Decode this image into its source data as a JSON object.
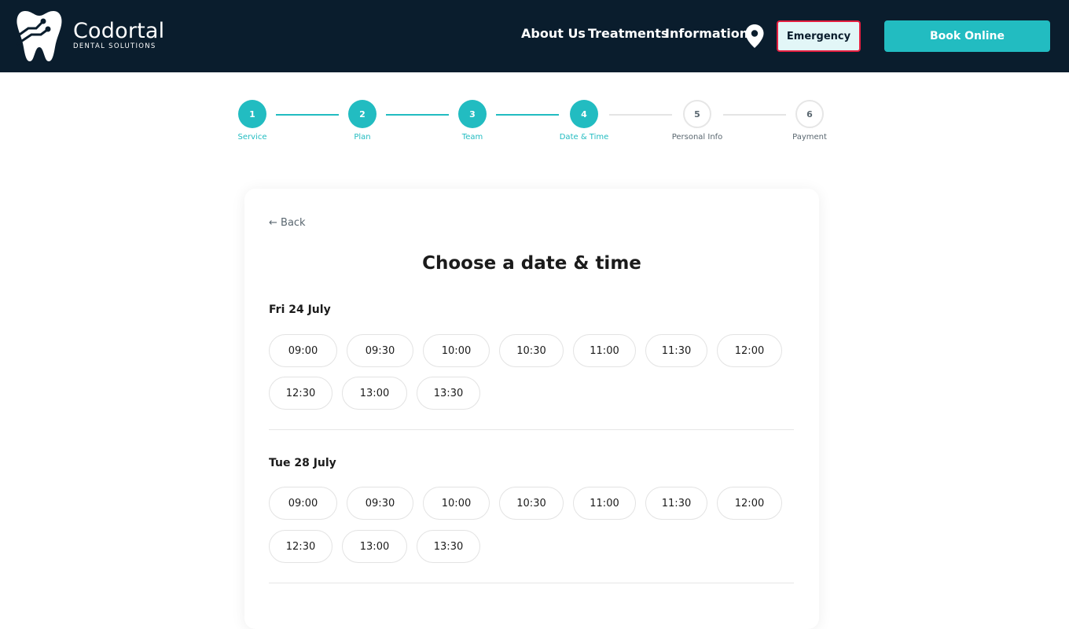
{
  "header": {
    "brand_name": "Codortal",
    "brand_sub": "DENTAL SOLUTIONS",
    "nav": [
      "About Us",
      "Treatments",
      "Information"
    ],
    "emergency_label": "Emergency",
    "book_label": "Book Online",
    "background": "#0a1d2d",
    "accent": "#22bcc1",
    "emergency_border": "#e41e3f"
  },
  "stepper": {
    "steps": [
      {
        "number": "1",
        "label": "Service",
        "state": "done"
      },
      {
        "number": "2",
        "label": "Plan",
        "state": "done"
      },
      {
        "number": "3",
        "label": "Team",
        "state": "done"
      },
      {
        "number": "4",
        "label": "Date & Time",
        "state": "done"
      },
      {
        "number": "5",
        "label": "Personal Info",
        "state": "todo"
      },
      {
        "number": "6",
        "label": "Payment",
        "state": "todo"
      }
    ]
  },
  "card": {
    "back_label": "← Back",
    "title": "Choose a date & time",
    "days": [
      {
        "date": "Fri 24 July",
        "slots": [
          "09:00",
          "09:30",
          "10:00",
          "10:30",
          "11:00",
          "11:30",
          "12:00",
          "12:30",
          "13:00",
          "13:30"
        ]
      },
      {
        "date": "Tue 28 July",
        "slots": [
          "09:00",
          "09:30",
          "10:00",
          "10:30",
          "11:00",
          "11:30",
          "12:00",
          "12:30",
          "13:00",
          "13:30"
        ]
      }
    ]
  }
}
